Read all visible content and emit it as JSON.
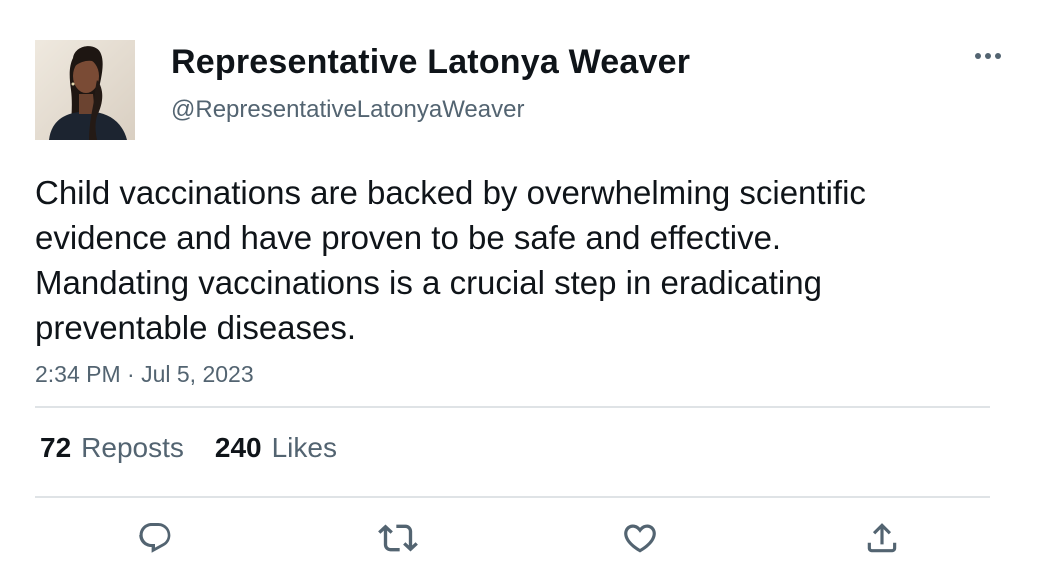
{
  "tweet": {
    "author": {
      "display_name": "Representative Latonya Weaver",
      "handle": "@RepresentativeLatonyaWeaver"
    },
    "text": "Child vaccinations are backed by overwhelming scientific evidence and have proven to be safe and effective. Mandating vaccinations is a crucial step in eradicating preventable diseases.",
    "timestamp": "2:34 PM · Jul 5, 2023",
    "stats": {
      "reposts_count": "72",
      "reposts_label": "Reposts",
      "likes_count": "240",
      "likes_label": "Likes"
    }
  },
  "icons": {
    "more": "more-horizontal-icon",
    "reply": "reply-icon",
    "repost": "repost-icon",
    "like": "heart-icon",
    "share": "share-icon"
  },
  "colors": {
    "text_primary": "#0f1419",
    "text_secondary": "#536471",
    "divider": "#dfe3e6"
  }
}
